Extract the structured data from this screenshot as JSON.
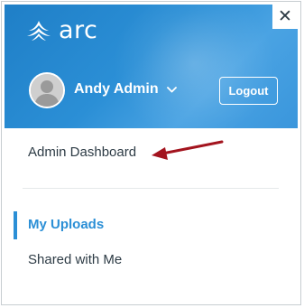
{
  "app": {
    "logo_text": "arc",
    "logo_icon": "arc-logo-icon"
  },
  "header": {
    "user_name": "Andy Admin",
    "logout_label": "Logout",
    "close_glyph": "✕"
  },
  "menu": {
    "admin_link": "Admin Dashboard",
    "nav": [
      {
        "label": "My Uploads",
        "active": true
      },
      {
        "label": "Shared with Me",
        "active": false
      }
    ]
  },
  "colors": {
    "brand_blue": "#2b8fd6",
    "text_dark": "#2d3b45",
    "annotation_arrow": "#a3141e"
  }
}
